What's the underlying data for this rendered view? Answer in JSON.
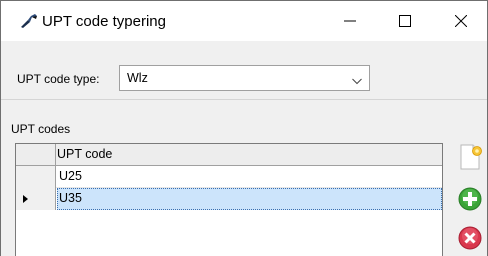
{
  "window": {
    "title": "UPT code typering",
    "icons": {
      "app": "wrench-icon",
      "minimize": "minimize-icon",
      "maximize": "maximize-icon",
      "close": "close-icon"
    }
  },
  "type_selector": {
    "label": "UPT code type:",
    "selected_value": "Wlz"
  },
  "codes": {
    "section_label": "UPT codes",
    "column_header": "UPT code",
    "rows": [
      {
        "value": "U25",
        "selected": false
      },
      {
        "value": "U35",
        "selected": true
      }
    ]
  },
  "actions": {
    "new_icon": "new-document-icon",
    "add_icon": "add-circle-icon",
    "delete_icon": "delete-circle-icon"
  },
  "colors": {
    "selection": "#cce4fb",
    "add_green": "#3aa437",
    "delete_red": "#d9374d"
  }
}
